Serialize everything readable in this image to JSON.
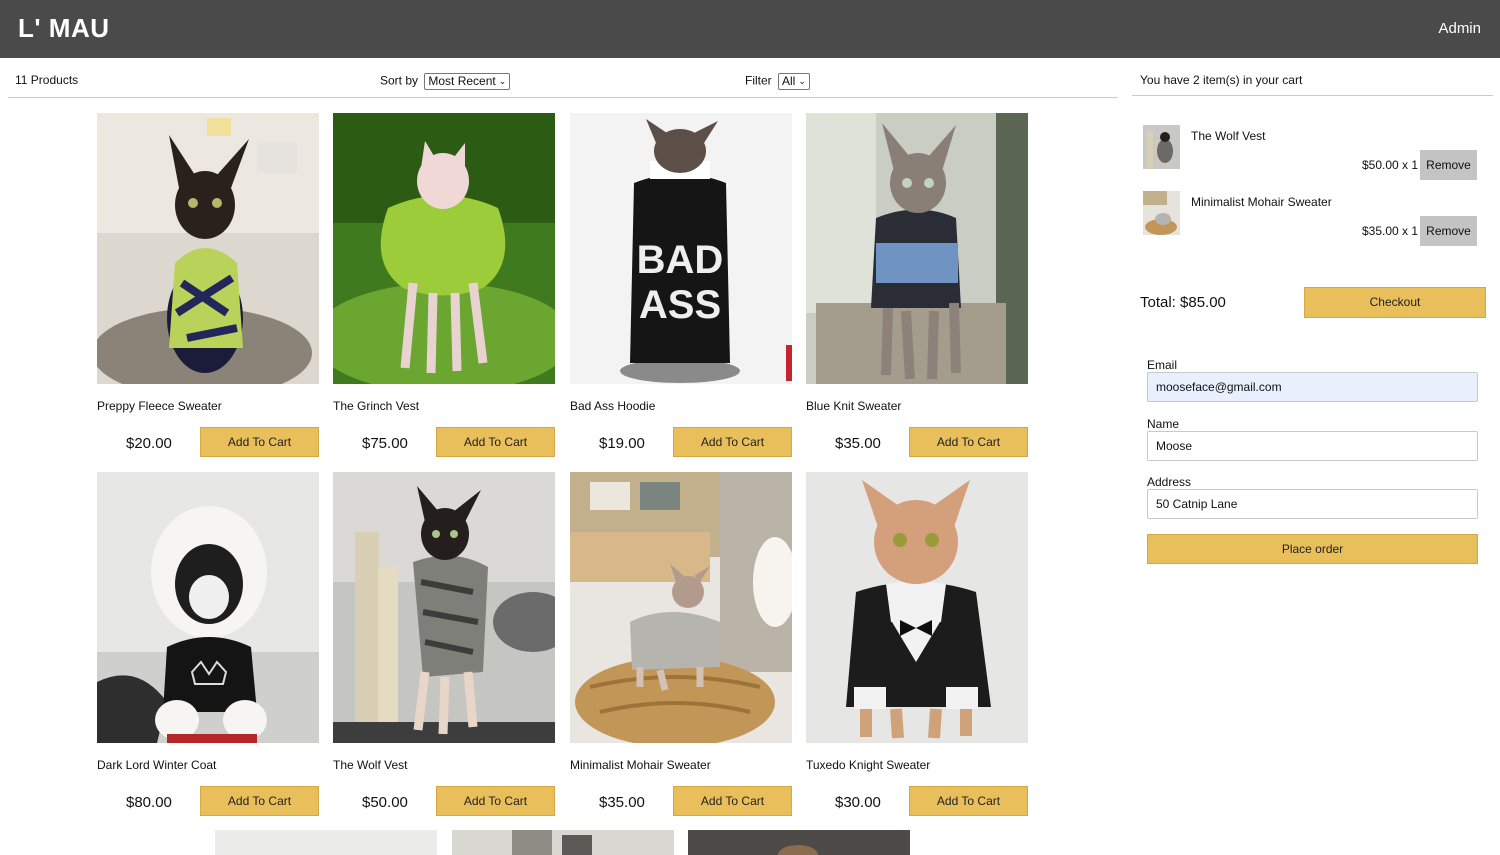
{
  "header": {
    "logo": "L' MAU",
    "admin_label": "Admin"
  },
  "filter_bar": {
    "count_text": "11 Products",
    "sort_label": "Sort by",
    "sort_value": "Most Recent",
    "filter_label": "Filter",
    "filter_value": "All"
  },
  "products": [
    {
      "title": "Preppy Fleece Sweater",
      "price": "$20.00",
      "button": "Add To Cart"
    },
    {
      "title": "The Grinch Vest",
      "price": "$75.00",
      "button": "Add To Cart"
    },
    {
      "title": "Bad Ass Hoodie",
      "price": "$19.00",
      "button": "Add To Cart",
      "print_text_top": "BAD",
      "print_text_bottom": "ASS"
    },
    {
      "title": "Blue Knit Sweater",
      "price": "$35.00",
      "button": "Add To Cart"
    },
    {
      "title": "Dark Lord Winter Coat",
      "price": "$80.00",
      "button": "Add To Cart"
    },
    {
      "title": "The Wolf Vest",
      "price": "$50.00",
      "button": "Add To Cart"
    },
    {
      "title": "Minimalist Mohair Sweater",
      "price": "$35.00",
      "button": "Add To Cart"
    },
    {
      "title": "Tuxedo Knight Sweater",
      "price": "$30.00",
      "button": "Add To Cart"
    }
  ],
  "cart": {
    "heading": "You have 2 item(s) in your cart",
    "items": [
      {
        "name": "The Wolf Vest",
        "price_qty": "$50.00 x 1",
        "remove_label": "Remove"
      },
      {
        "name": "Minimalist Mohair Sweater",
        "price_qty": "$35.00 x 1",
        "remove_label": "Remove"
      }
    ],
    "total_text": "Total: $85.00",
    "checkout_label": "Checkout"
  },
  "order_form": {
    "email_label": "Email",
    "email_value": "mooseface@gmail.com",
    "name_label": "Name",
    "name_value": "Moose",
    "address_label": "Address",
    "address_value": "50 Catnip Lane",
    "place_order_label": "Place order"
  },
  "colors": {
    "header_bg": "#4a4a4a",
    "accent_button": "#e8bf5b",
    "remove_button": "#c4c4c4",
    "divider": "#d8c7bd"
  }
}
